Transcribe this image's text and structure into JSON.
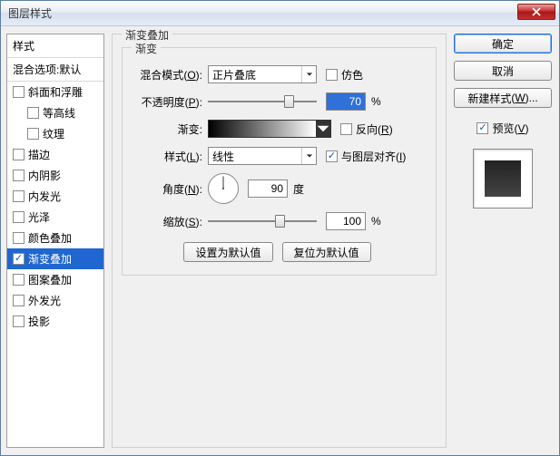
{
  "window": {
    "title": "图层样式"
  },
  "left": {
    "header": "样式",
    "blend_options": "混合选项:默认",
    "items": [
      {
        "label": "斜面和浮雕",
        "checked": false,
        "child": false
      },
      {
        "label": "等高线",
        "checked": false,
        "child": true
      },
      {
        "label": "纹理",
        "checked": false,
        "child": true
      },
      {
        "label": "描边",
        "checked": false,
        "child": false
      },
      {
        "label": "内阴影",
        "checked": false,
        "child": false
      },
      {
        "label": "内发光",
        "checked": false,
        "child": false
      },
      {
        "label": "光泽",
        "checked": false,
        "child": false
      },
      {
        "label": "颜色叠加",
        "checked": false,
        "child": false
      },
      {
        "label": "渐变叠加",
        "checked": true,
        "child": false,
        "selected": true
      },
      {
        "label": "图案叠加",
        "checked": false,
        "child": false
      },
      {
        "label": "外发光",
        "checked": false,
        "child": false
      },
      {
        "label": "投影",
        "checked": false,
        "child": false
      }
    ]
  },
  "center": {
    "group_title": "渐变叠加",
    "inner_title": "渐变",
    "blend_mode": {
      "label": "混合模式",
      "key": "O",
      "value": "正片叠底"
    },
    "dither": "仿色",
    "opacity": {
      "label": "不透明度",
      "key": "P",
      "value": "70",
      "unit": "%"
    },
    "gradient": {
      "label": "渐变:",
      "reverse": "反向",
      "reverse_key": "R"
    },
    "style": {
      "label": "样式",
      "key": "L",
      "value": "线性",
      "align": "与图层对齐",
      "align_key": "I"
    },
    "angle": {
      "label": "角度",
      "key": "N",
      "value": "90",
      "unit": "度"
    },
    "scale": {
      "label": "缩放",
      "key": "S",
      "value": "100",
      "unit": "%"
    },
    "buttons": {
      "make_default": "设置为默认值",
      "reset_default": "复位为默认值"
    }
  },
  "right": {
    "ok": "确定",
    "cancel": "取消",
    "new_style": "新建样式",
    "new_style_key": "W",
    "preview": "预览",
    "preview_key": "V"
  }
}
